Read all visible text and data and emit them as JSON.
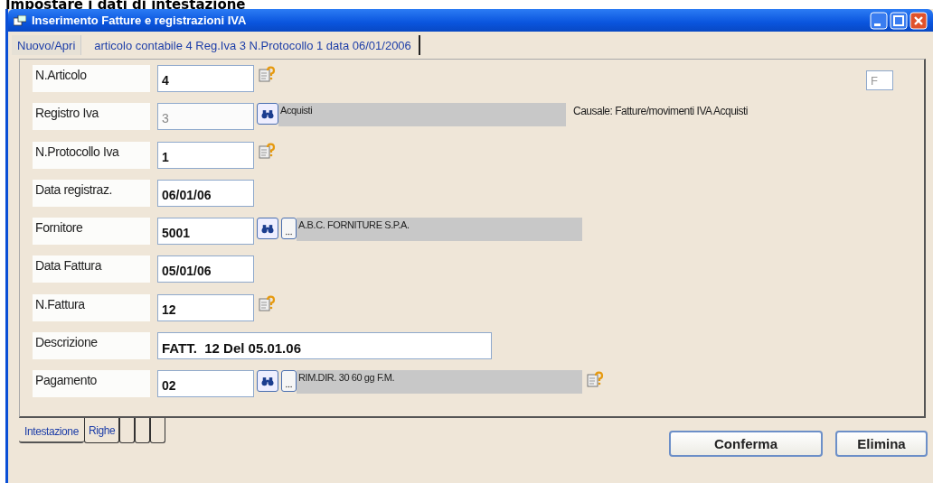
{
  "heading": "Impostare i dati di intestazione",
  "window": {
    "title": "Inserimento Fatture e registrazioni IVA"
  },
  "top_tabs": [
    {
      "label": "Nuovo/Apri",
      "selected": false
    },
    {
      "label": "articolo contabile 4 Reg.Iva 3 N.Protocollo 1 data 06/01/2006",
      "selected": true
    }
  ],
  "fields": [
    {
      "label": "N.Articolo",
      "value": "4",
      "kind": "plain",
      "disabled": false,
      "help": true,
      "side_field": "F"
    },
    {
      "label": "Registro Iva",
      "value": "3",
      "kind": "lookup",
      "disabled": true,
      "help": false,
      "description": "Acquisti",
      "note": "Causale: Fatture/movimenti IVA Acquisti"
    },
    {
      "label": "N.Protocollo Iva",
      "value": "1",
      "kind": "plain",
      "disabled": false,
      "help": true
    },
    {
      "label": "Data registraz.",
      "value": "06/01/06",
      "kind": "plain",
      "disabled": false,
      "help": false
    },
    {
      "label": "Fornitore",
      "value": "5001",
      "kind": "lookup_more",
      "disabled": false,
      "help": false,
      "description": "A.B.C. FORNITURE S.P.A."
    },
    {
      "label": "Data Fattura",
      "value": "05/01/06",
      "kind": "plain",
      "disabled": false,
      "help": false
    },
    {
      "label": "N.Fattura",
      "value": "12",
      "kind": "plain",
      "disabled": false,
      "help": true
    },
    {
      "label": "Descrizione",
      "value": "FATT.  12 Del 05.01.06",
      "kind": "wide",
      "disabled": false,
      "help": false
    },
    {
      "label": "Pagamento",
      "value": "02",
      "kind": "lookup_more",
      "disabled": false,
      "help": true,
      "description": "RIM.DIR. 30 60 gg F.M."
    }
  ],
  "bottom_tabs": [
    {
      "label": "Intestazione",
      "selected": true
    },
    {
      "label": "Righe",
      "selected": false
    }
  ],
  "buttons": [
    "Conferma",
    "Elimina"
  ]
}
